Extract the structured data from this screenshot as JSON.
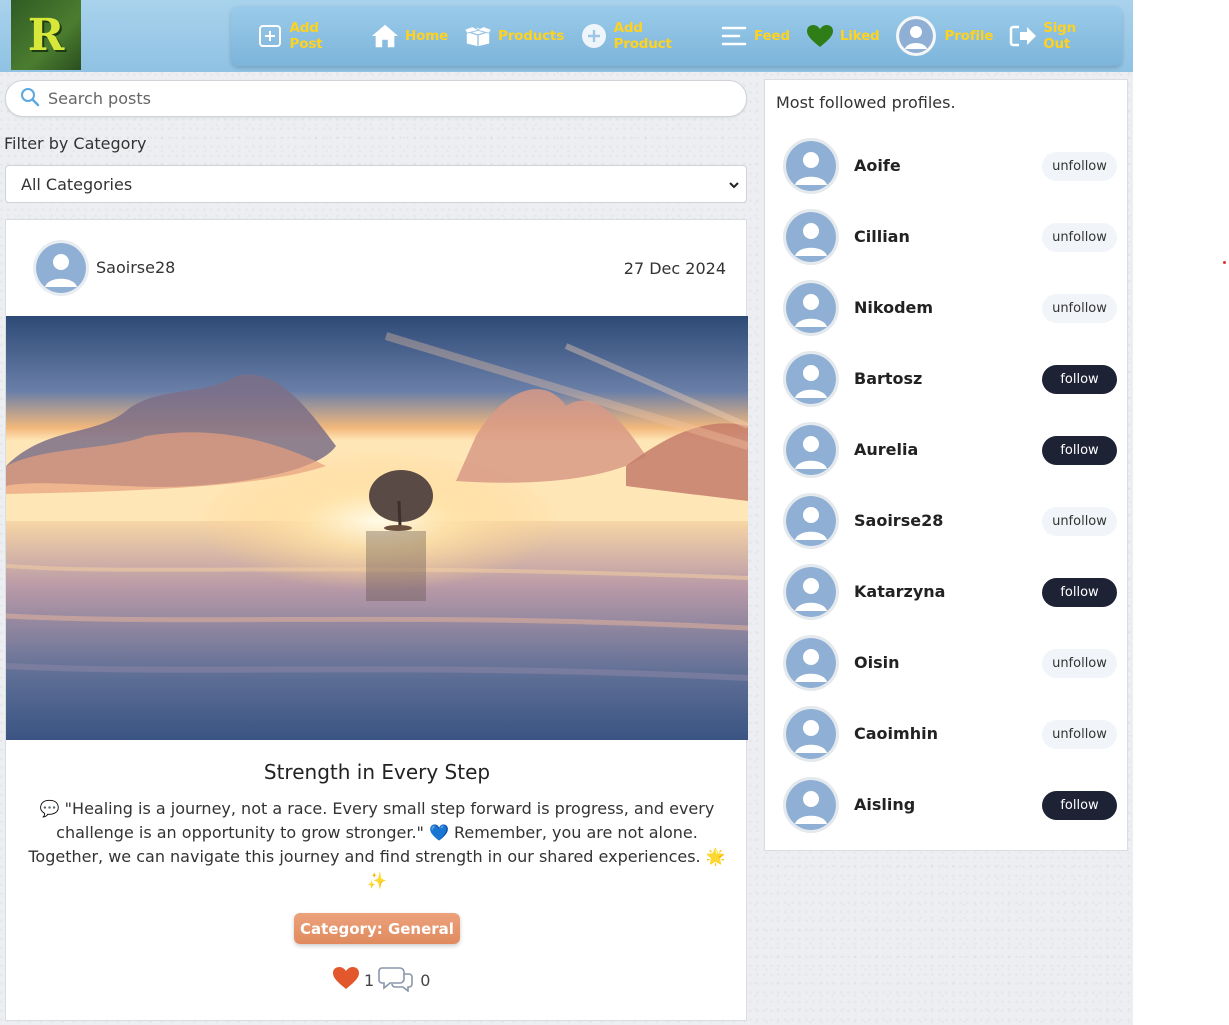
{
  "app": {
    "logo_letter": "R"
  },
  "nav": {
    "items": [
      {
        "label": "Add Post",
        "icon": "plus-square-icon"
      },
      {
        "label": "Home",
        "icon": "home-icon"
      },
      {
        "label": "Products",
        "icon": "box-icon"
      },
      {
        "label": "Add Product",
        "icon": "plus-circle-icon"
      },
      {
        "label": "Feed",
        "icon": "list-icon"
      },
      {
        "label": "Liked",
        "icon": "heart-icon"
      },
      {
        "label": "Profile",
        "icon": "avatar-icon"
      },
      {
        "label": "Sign Out",
        "icon": "sign-out-icon"
      }
    ]
  },
  "search": {
    "placeholder": "Search posts",
    "value": ""
  },
  "filter": {
    "label": "Filter by Category",
    "selected": "All Categories"
  },
  "post": {
    "author": "Saoirse28",
    "date": "27 Dec 2024",
    "title": "Strength in Every Step",
    "body": "💬 \"Healing is a journey, not a race. Every small step forward is progress, and every challenge is an opportunity to grow stronger.\" 💙 Remember, you are not alone. Together, we can navigate this journey and find strength in our shared experiences. 🌟✨",
    "category": "Category: General",
    "likes": "1",
    "comments": "0"
  },
  "sidebar": {
    "title": "Most followed profiles.",
    "profiles": [
      {
        "name": "Aoife",
        "action": "unfollow"
      },
      {
        "name": "Cillian",
        "action": "unfollow"
      },
      {
        "name": "Nikodem",
        "action": "unfollow"
      },
      {
        "name": "Bartosz",
        "action": "follow"
      },
      {
        "name": "Aurelia",
        "action": "follow"
      },
      {
        "name": "Saoirse28",
        "action": "unfollow"
      },
      {
        "name": "Katarzyna",
        "action": "follow"
      },
      {
        "name": "Oisin",
        "action": "unfollow"
      },
      {
        "name": "Caoimhin",
        "action": "unfollow"
      },
      {
        "name": "Aisling",
        "action": "follow"
      }
    ]
  },
  "colors": {
    "nav_text": "#ffd21f",
    "nav_bg": "#8fc2e4",
    "follow_bg": "#1e2235",
    "unfollow_bg": "#f1f4f8",
    "category_bg": "#e08a5e",
    "heart": "#e2572c"
  }
}
